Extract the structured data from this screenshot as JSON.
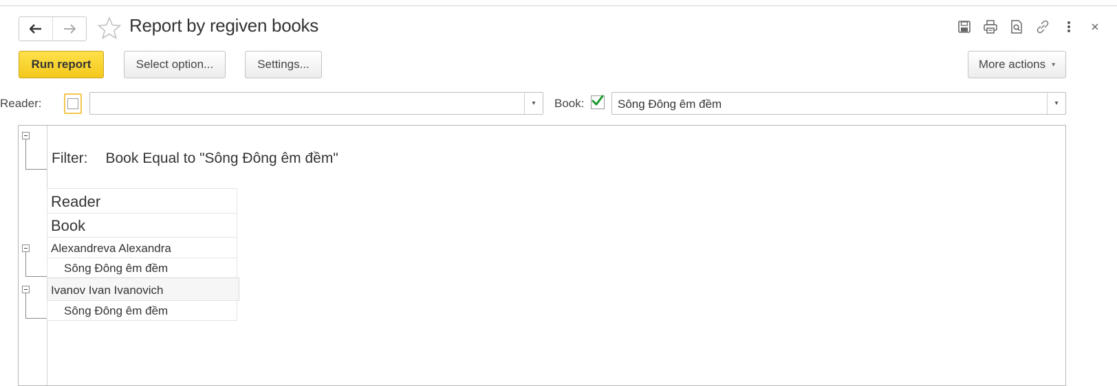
{
  "window": {
    "title": "Report by regiven books"
  },
  "toolbar": {
    "run_label": "Run report",
    "select_option_label": "Select option...",
    "settings_label": "Settings...",
    "more_actions_label": "More actions",
    "icons": [
      "save-icon",
      "print-icon",
      "preview-icon",
      "link-icon",
      "more-vert-icon",
      "close-icon"
    ]
  },
  "filters": {
    "reader_label": "Reader:",
    "reader_checked": false,
    "reader_value": "",
    "book_label": "Book:",
    "book_checked": true,
    "book_value": "Sông Đông êm đềm"
  },
  "report": {
    "filter_prefix": "Filter:",
    "filter_text": "Book Equal to \"Sông Đông êm đềm\"",
    "headers": [
      "Reader",
      "Book"
    ],
    "rows": [
      {
        "reader": "Alexandreva Alexandra",
        "book": "Sông Đông êm đềm"
      },
      {
        "reader": "Ivanov Ivan Ivanovich",
        "book": "Sông Đông êm đềm"
      }
    ]
  },
  "colors": {
    "accent": "#f3c81c",
    "check_green": "#1a9a2c",
    "border": "#c2c2c2"
  }
}
